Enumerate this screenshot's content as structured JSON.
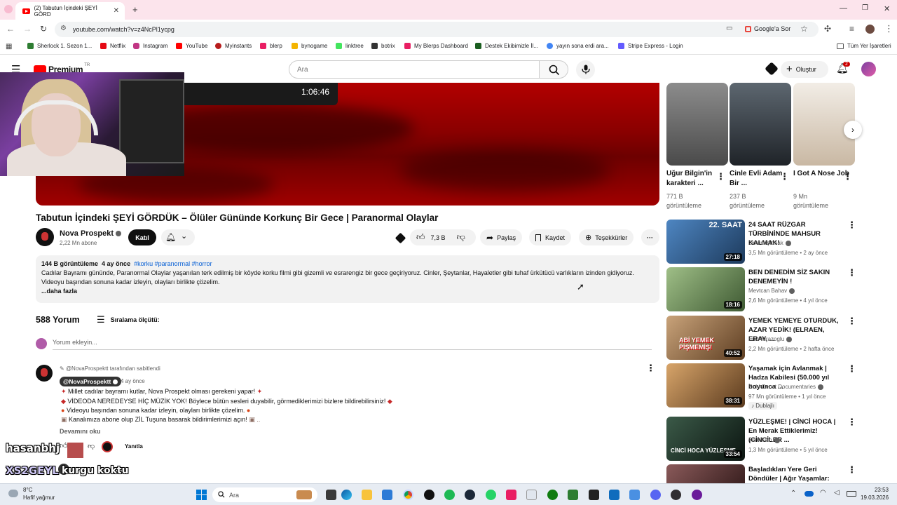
{
  "browser": {
    "tab_title": "(2) Tabutun İçindeki ŞEYİ GÖRD",
    "url": "youtube.com/watch?v=z4NcPl1ycpg",
    "google_ask": "Google'a Sor",
    "bookmarks": [
      {
        "label": "Sherlock 1. Sezon 1...",
        "color": "#2e7d32"
      },
      {
        "label": "Netflix",
        "color": "#e50914"
      },
      {
        "label": "Instagram",
        "color": "#c13584"
      },
      {
        "label": "YouTube",
        "color": "#ff0000"
      },
      {
        "label": "Myinstants",
        "color": "#b71c1c"
      },
      {
        "label": "blerp",
        "color": "#e91e63"
      },
      {
        "label": "bynogame",
        "color": "#f4b400"
      },
      {
        "label": "linktree",
        "color": "#43e55e"
      },
      {
        "label": "botrix",
        "color": "#333333"
      },
      {
        "label": "My Blerps Dashboard",
        "color": "#e91e63"
      },
      {
        "label": "Destek Ekibimizle İl...",
        "color": "#1b5e20"
      },
      {
        "label": "yayın sona erdi ara...",
        "color": "#4285f4"
      },
      {
        "label": "Stripe Express - Login",
        "color": "#635bff"
      }
    ],
    "all_bookmarks": "Tüm Yer İşaretleri"
  },
  "youtube": {
    "logo": "Premium",
    "logo_sup": "TR",
    "search_placeholder": "Ara",
    "create_label": "Oluştur",
    "notif_count": "2"
  },
  "video": {
    "pip_time": "1:06:46",
    "title": "Tabutun İçindeki ŞEYİ GÖRDÜK – Ölüler Gününde Korkunç Bir Gece | Paranormal Olaylar",
    "channel": "Nova Prospekt",
    "subs": "2,22 Mn abone",
    "join": "Katıl",
    "likes": "7,3 B",
    "share": "Paylaş",
    "save": "Kaydet",
    "thanks": "Teşekkürler",
    "desc_views": "144 B görüntüleme",
    "desc_time": "4 ay önce",
    "desc_tags": "#korku #paranormal #horror",
    "desc_line1": "Cadılar Bayramı gününde, Paranormal Olaylar yaşanılan terk edilmiş bir köyde korku filmi gibi gizemli ve esrarengiz bir gece geçiriyoruz. Cinler, Şeytanlar, Hayaletler gibi tuhaf ürkütücü varlıkların izinden gidiyoruz.",
    "desc_line2": "Videoyu başından sonuna kadar izleyin, olayları birlikte çözelim.",
    "desc_more": "...daha fazla"
  },
  "comments": {
    "count": "588 Yorum",
    "sort": "Sıralama ölçütü:",
    "add_placeholder": "Yorum ekleyin...",
    "pinned_by": "@NovaProspektt tarafından sabitlendi",
    "author": "@NovaProspektt",
    "time": "4 ay önce",
    "lines": [
      "Millet cadılar bayramı kutlar, Nova Prospekt olması gerekeni yapar!",
      "VİDEODA NEREDEYSE HİÇ MÜZİK YOK! Böylece bütün sesleri duyabilir, görmediklerimizi bizlere bildirebilirsiniz!",
      "Videoyu başından sonuna kadar izleyin, olayları birlikte çözelim.",
      "Kanalımıza abone olup ZİL Tuşuna basarak bildirimlerimizi açın!"
    ],
    "read_more": "Devamını oku",
    "reply": "Yanıtla",
    "overlay_1": "hasanbhj",
    "overlay_2": "XS2GEYL",
    "overlay_3": "kurgu koktu"
  },
  "shorts": [
    {
      "title": "Uğur Bilgin'in karakteri ...",
      "views": "771 B görüntüleme",
      "bg": "#6d6d6d"
    },
    {
      "title": "Cinle Evli Adam Bir ...",
      "views": "237 B görüntüleme",
      "bg": "#3a4047"
    },
    {
      "title": "I Got A Nose Job",
      "views": "9 Mn görüntüleme",
      "bg": "#c9b8a3"
    }
  ],
  "recommended": [
    {
      "title": "24 SAAT RÜZGAR TÜRBİNİNDE MAHSUR KALMAK!",
      "channel": "Orkun Işıtmak",
      "meta": "3,5 Mn görüntüleme • 2 ay önce",
      "duration": "27:18",
      "thumb_label": "22. SAAT",
      "bg": "#2f5a86"
    },
    {
      "title": "BEN DENEDİM SİZ SAKIN DENEMEYİN !",
      "channel": "Mevtcan Bahav",
      "meta": "2,6 Mn görüntüleme • 4 yıl önce",
      "duration": "18:16",
      "thumb_label": "",
      "bg": "#6a8b5a"
    },
    {
      "title": "YEMEK YEMEYE OTURDUK, AZAR YEDİK! (ELRAEN, ERAY, ...",
      "channel": "Enis Kirazoglu",
      "meta": "2,2 Mn görüntüleme • 2 hafta önce",
      "duration": "40:52",
      "thumb_label": "ABİ YEMEK PİŞMEMİŞ!",
      "bg": "#8a6a4a"
    },
    {
      "title": "Yaşamak için Avlanmak | Hadza Kabilesi (50.000 yıl boyunca ...",
      "channel": "Ruhi Cenet Documentaries",
      "meta": "97 Mn görüntüleme • 1 yıl önce",
      "duration": "38:31",
      "thumb_label": "",
      "badge": "Dublajlı",
      "bg": "#9b6b3f"
    },
    {
      "title": "YÜZLEŞME! | CİNCİ HOCA | En Merak Ettiklerimiz! (CİNCİLER ...",
      "channel": "Yer6 Film",
      "meta": "1,3 Mn görüntüleme • 5 yıl önce",
      "duration": "33:54",
      "thumb_label": "CİNCİ HOCA YÜZLEŞME",
      "bg": "#1c2a22"
    },
    {
      "title": "Başladıkları Yere Geri Döndüler | Ağır Yaşamlar: Şimdi Ne ...",
      "channel": "",
      "meta": "",
      "duration": "",
      "thumb_label": "",
      "bg": "#7a5050"
    }
  ],
  "taskbar": {
    "temp": "8°C",
    "weather": "Hafif yağmur",
    "search": "Ara",
    "time": "23:53",
    "date": "19.03.2026"
  }
}
